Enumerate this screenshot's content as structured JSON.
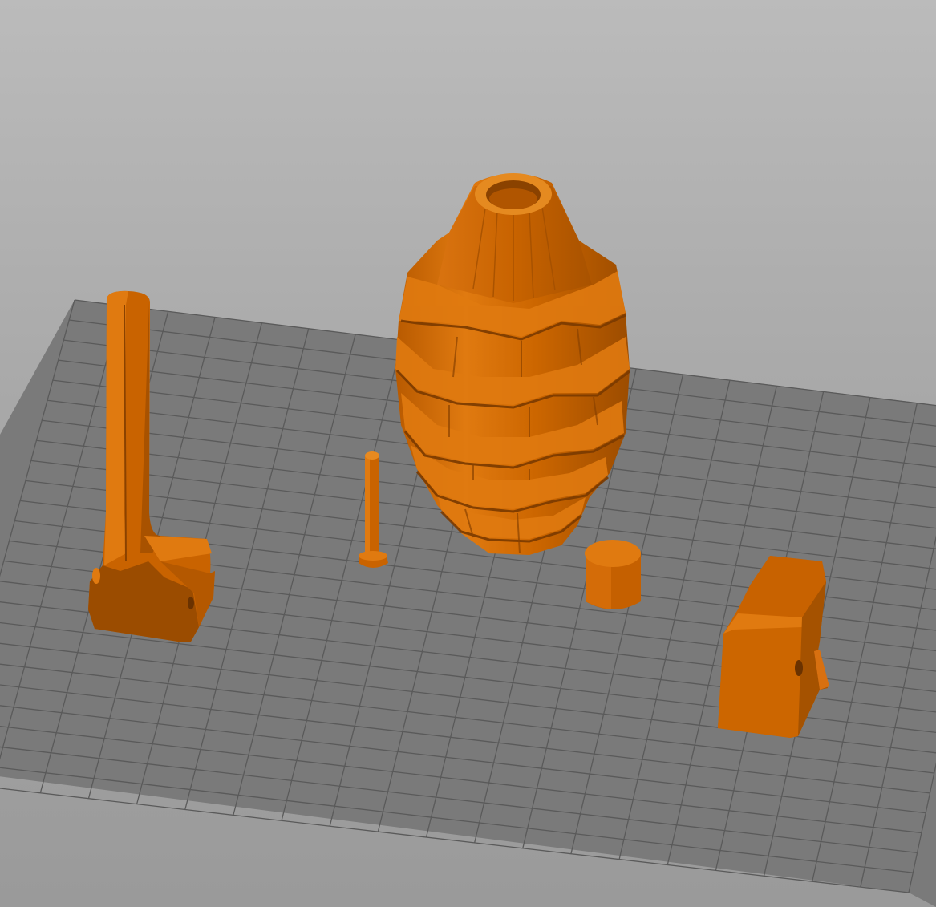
{
  "viewport": {
    "background_top": "#bbbbbb",
    "background_bottom": "#9a9a9a"
  },
  "bed": {
    "plate_color": "#787878",
    "grid_line_color": "#5a5a5a",
    "columns": 20,
    "rows": 24
  },
  "model_colors": {
    "base": "#cc6600",
    "light": "#e07a10",
    "dark": "#8a4200",
    "shade": "#a55200"
  },
  "objects": [
    "grenade-body",
    "safety-lever",
    "firing-pin",
    "cylinder-cap",
    "fuse-block"
  ]
}
